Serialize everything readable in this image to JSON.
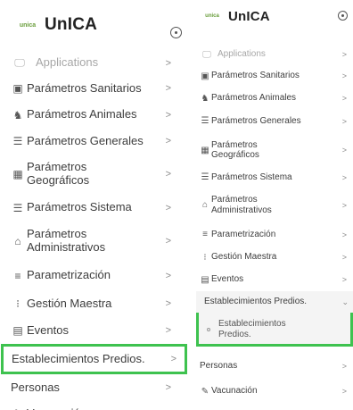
{
  "brand": {
    "logo_text": "unica",
    "name": "UnICA"
  },
  "menu": {
    "applications": "Applications",
    "sanitarios": "Parámetros Sanitarios",
    "animales": "Parámetros Animales",
    "generales": "Parámetros Generales",
    "geograficos": "Parámetros Geográficos",
    "sistema": "Parámetros Sistema",
    "administrativos": "Parámetros Administrativos",
    "parametrizacion": "Parametrización",
    "gestion": "Gestión Maestra",
    "eventos": "Eventos",
    "establecimientos": "Establecimientos Predios.",
    "establecimientos_sub": "Establecimientos Predios.",
    "personas": "Personas",
    "vacunacion": "Vacunación"
  },
  "icons": {
    "applications": "monitor-icon",
    "sanitarios": "clipboard-icon",
    "animales": "cattle-icon",
    "generales": "sliders-icon",
    "geograficos": "map-icon",
    "sistema": "sliders-icon",
    "administrativos": "building-icon",
    "parametrizacion": "lines-icon",
    "gestion": "list-icon",
    "eventos": "calendar-icon",
    "vacunacion": "syringe-icon"
  },
  "colors": {
    "highlight": "#3ec24f",
    "logo": "#6a9e3c"
  },
  "chevrons": {
    "collapsed": ">",
    "expanded": "⌄"
  }
}
